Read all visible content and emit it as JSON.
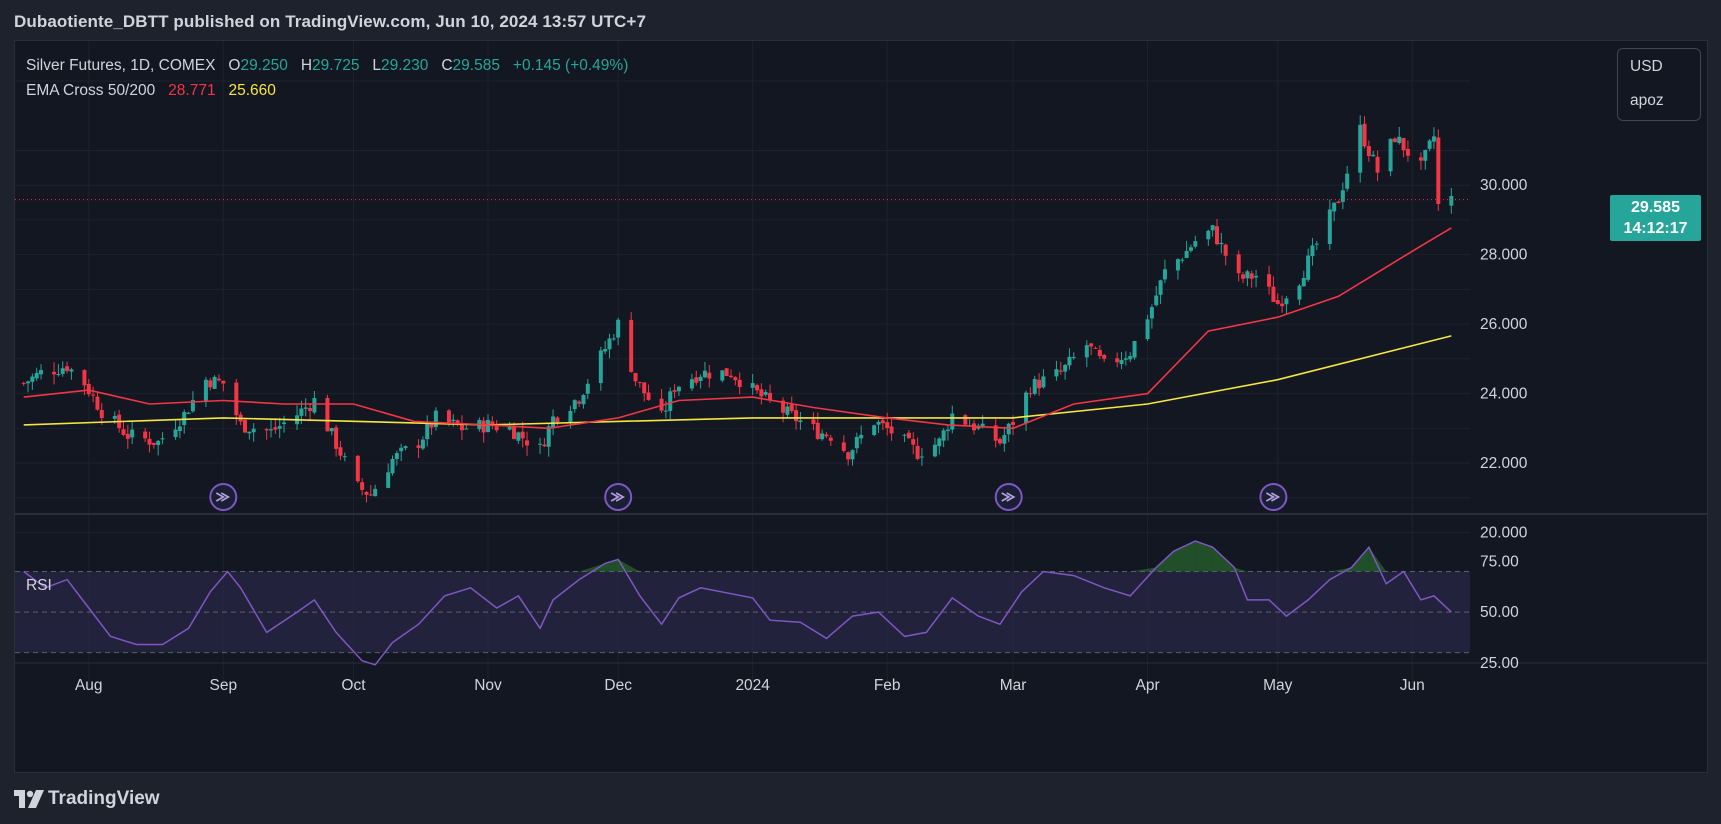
{
  "header": {
    "published_line": "Dubaotiente_DBTT published on TradingView.com, Jun 10, 2024 13:57 UTC+7"
  },
  "legend": {
    "symbol": "Silver Futures, 1D, COMEX",
    "open_key": "O",
    "open": "29.250",
    "high_key": "H",
    "high": "29.725",
    "low_key": "L",
    "low": "29.230",
    "close_key": "C",
    "close": "29.585",
    "change": "+0.145 (+0.49%)",
    "ema_label": "EMA Cross 50/200",
    "ema50": "28.771",
    "ema200": "25.660"
  },
  "currency": {
    "code": "USD",
    "unit": "apoz"
  },
  "price_badge": {
    "price": "29.585",
    "countdown": "14:12:17"
  },
  "rsi_label": "RSI",
  "footer": {
    "brand": "TradingView"
  },
  "colors": {
    "background": "#131722",
    "up": "#26a69a",
    "down": "#f23645",
    "ema50": "#f23645",
    "ema200": "#f5e642",
    "rsi_line": "#7e57c2",
    "rsi_band": "#2a2745",
    "grid": "#1e222d"
  },
  "chart_data": [
    {
      "type": "candlestick",
      "title": "Silver Futures, 1D, COMEX",
      "x_tick_labels": [
        "Aug",
        "Sep",
        "Oct",
        "Nov",
        "Dec",
        "2024",
        "Feb",
        "Mar",
        "Apr",
        "May",
        "Jun"
      ],
      "y_tick_labels": [
        "20.000",
        "22.000",
        "24.000",
        "26.000",
        "28.000",
        "30.000"
      ],
      "ylim": [
        19.9,
        33.0
      ],
      "current_price": 29.585,
      "price_path": [
        [
          "2023-07-17",
          24.3
        ],
        [
          "2023-07-21",
          24.6
        ],
        [
          "2023-07-27",
          24.8
        ],
        [
          "2023-07-31",
          24.3
        ],
        [
          "2023-08-04",
          23.5
        ],
        [
          "2023-08-10",
          22.8
        ],
        [
          "2023-08-17",
          22.6
        ],
        [
          "2023-08-23",
          23.4
        ],
        [
          "2023-08-28",
          24.4
        ],
        [
          "2023-09-01",
          24.3
        ],
        [
          "2023-09-05",
          23.1
        ],
        [
          "2023-09-12",
          22.9
        ],
        [
          "2023-09-18",
          23.4
        ],
        [
          "2023-09-22",
          23.8
        ],
        [
          "2023-09-26",
          22.8
        ],
        [
          "2023-10-02",
          21.3
        ],
        [
          "2023-10-05",
          21.1
        ],
        [
          "2023-10-10",
          22.1
        ],
        [
          "2023-10-16",
          22.6
        ],
        [
          "2023-10-20",
          23.3
        ],
        [
          "2023-10-26",
          23.0
        ],
        [
          "2023-11-01",
          23.1
        ],
        [
          "2023-11-06",
          23.0
        ],
        [
          "2023-11-13",
          22.4
        ],
        [
          "2023-11-16",
          23.3
        ],
        [
          "2023-11-22",
          23.9
        ],
        [
          "2023-11-28",
          25.3
        ],
        [
          "2023-12-01",
          26.0
        ],
        [
          "2023-12-05",
          24.4
        ],
        [
          "2023-12-11",
          23.3
        ],
        [
          "2023-12-14",
          24.2
        ],
        [
          "2023-12-20",
          24.6
        ],
        [
          "2023-12-27",
          24.6
        ],
        [
          "2024-01-02",
          24.0
        ],
        [
          "2024-01-08",
          23.5
        ],
        [
          "2024-01-16",
          22.9
        ],
        [
          "2024-01-19",
          22.8
        ],
        [
          "2024-01-23",
          22.3
        ],
        [
          "2024-01-29",
          23.2
        ],
        [
          "2024-02-02",
          22.9
        ],
        [
          "2024-02-08",
          22.3
        ],
        [
          "2024-02-13",
          22.6
        ],
        [
          "2024-02-16",
          23.4
        ],
        [
          "2024-02-22",
          23.0
        ],
        [
          "2024-02-27",
          22.6
        ],
        [
          "2024-03-01",
          23.2
        ],
        [
          "2024-03-05",
          24.2
        ],
        [
          "2024-03-12",
          24.6
        ],
        [
          "2024-03-18",
          25.4
        ],
        [
          "2024-03-22",
          24.8
        ],
        [
          "2024-03-28",
          25.2
        ],
        [
          "2024-04-02",
          26.5
        ],
        [
          "2024-04-05",
          27.5
        ],
        [
          "2024-04-10",
          28.1
        ],
        [
          "2024-04-12",
          28.4
        ],
        [
          "2024-04-16",
          28.7
        ],
        [
          "2024-04-22",
          27.3
        ],
        [
          "2024-04-26",
          27.4
        ],
        [
          "2024-05-01",
          26.6
        ],
        [
          "2024-05-06",
          27.3
        ],
        [
          "2024-05-10",
          28.3
        ],
        [
          "2024-05-15",
          29.6
        ],
        [
          "2024-05-20",
          31.6
        ],
        [
          "2024-05-24",
          30.4
        ],
        [
          "2024-05-28",
          31.4
        ],
        [
          "2024-06-03",
          30.5
        ],
        [
          "2024-06-06",
          31.4
        ],
        [
          "2024-06-07",
          29.4
        ],
        [
          "2024-06-10",
          29.585
        ]
      ],
      "ema50_path": [
        [
          "2023-07-17",
          23.9
        ],
        [
          "2023-08-01",
          24.1
        ],
        [
          "2023-08-15",
          23.7
        ],
        [
          "2023-09-01",
          23.8
        ],
        [
          "2023-09-15",
          23.7
        ],
        [
          "2023-10-01",
          23.7
        ],
        [
          "2023-10-15",
          23.2
        ],
        [
          "2023-11-01",
          23.1
        ],
        [
          "2023-11-15",
          23.0
        ],
        [
          "2023-12-01",
          23.3
        ],
        [
          "2023-12-15",
          23.8
        ],
        [
          "2024-01-01",
          23.9
        ],
        [
          "2024-01-15",
          23.6
        ],
        [
          "2024-02-01",
          23.3
        ],
        [
          "2024-02-15",
          23.1
        ],
        [
          "2024-03-01",
          23.0
        ],
        [
          "2024-03-15",
          23.7
        ],
        [
          "2024-04-01",
          24.0
        ],
        [
          "2024-04-15",
          25.8
        ],
        [
          "2024-05-01",
          26.2
        ],
        [
          "2024-05-15",
          26.8
        ],
        [
          "2024-06-01",
          28.1
        ],
        [
          "2024-06-10",
          28.771
        ]
      ],
      "ema200_path": [
        [
          "2023-07-17",
          23.1
        ],
        [
          "2023-09-01",
          23.3
        ],
        [
          "2023-11-01",
          23.1
        ],
        [
          "2024-01-01",
          23.3
        ],
        [
          "2024-02-01",
          23.3
        ],
        [
          "2024-03-01",
          23.3
        ],
        [
          "2024-04-01",
          23.7
        ],
        [
          "2024-05-01",
          24.4
        ],
        [
          "2024-06-10",
          25.66
        ]
      ],
      "series": [
        {
          "name": "EMA Cross 50/200 (50)",
          "last": 28.771
        },
        {
          "name": "EMA Cross 50/200 (200)",
          "last": 25.66
        }
      ],
      "event_marker_dates": [
        "2023-09-01",
        "2023-12-01",
        "2024-02-29",
        "2024-04-30"
      ]
    },
    {
      "type": "line",
      "title": "RSI",
      "y_tick_labels": [
        "25.00",
        "50.00",
        "75.00"
      ],
      "ylim": [
        16,
        90
      ],
      "bands": [
        30,
        50,
        70
      ],
      "rsi_path": [
        [
          "2023-07-17",
          70
        ],
        [
          "2023-07-22",
          62
        ],
        [
          "2023-07-27",
          66
        ],
        [
          "2023-08-01",
          52
        ],
        [
          "2023-08-06",
          38
        ],
        [
          "2023-08-12",
          34
        ],
        [
          "2023-08-18",
          34
        ],
        [
          "2023-08-24",
          42
        ],
        [
          "2023-08-29",
          60
        ],
        [
          "2023-09-02",
          70
        ],
        [
          "2023-09-05",
          62
        ],
        [
          "2023-09-11",
          40
        ],
        [
          "2023-09-18",
          50
        ],
        [
          "2023-09-22",
          56
        ],
        [
          "2023-09-27",
          40
        ],
        [
          "2023-10-03",
          26
        ],
        [
          "2023-10-06",
          24
        ],
        [
          "2023-10-10",
          35
        ],
        [
          "2023-10-16",
          44
        ],
        [
          "2023-10-22",
          58
        ],
        [
          "2023-10-28",
          62
        ],
        [
          "2023-11-03",
          52
        ],
        [
          "2023-11-08",
          58
        ],
        [
          "2023-11-13",
          42
        ],
        [
          "2023-11-16",
          56
        ],
        [
          "2023-11-22",
          66
        ],
        [
          "2023-11-28",
          74
        ],
        [
          "2023-12-01",
          76
        ],
        [
          "2023-12-06",
          58
        ],
        [
          "2023-12-11",
          44
        ],
        [
          "2023-12-15",
          57
        ],
        [
          "2023-12-20",
          62
        ],
        [
          "2024-01-01",
          57
        ],
        [
          "2024-01-05",
          46
        ],
        [
          "2024-01-12",
          45
        ],
        [
          "2024-01-18",
          37
        ],
        [
          "2024-01-24",
          48
        ],
        [
          "2024-01-30",
          50
        ],
        [
          "2024-02-05",
          38
        ],
        [
          "2024-02-10",
          40
        ],
        [
          "2024-02-16",
          57
        ],
        [
          "2024-02-22",
          48
        ],
        [
          "2024-02-27",
          44
        ],
        [
          "2024-03-03",
          60
        ],
        [
          "2024-03-08",
          70
        ],
        [
          "2024-03-15",
          68
        ],
        [
          "2024-03-22",
          62
        ],
        [
          "2024-03-28",
          58
        ],
        [
          "2024-04-03",
          72
        ],
        [
          "2024-04-07",
          80
        ],
        [
          "2024-04-12",
          85
        ],
        [
          "2024-04-16",
          82
        ],
        [
          "2024-04-21",
          72
        ],
        [
          "2024-04-24",
          56
        ],
        [
          "2024-04-29",
          56
        ],
        [
          "2024-05-03",
          48
        ],
        [
          "2024-05-08",
          56
        ],
        [
          "2024-05-13",
          66
        ],
        [
          "2024-05-18",
          72
        ],
        [
          "2024-05-22",
          82
        ],
        [
          "2024-05-26",
          64
        ],
        [
          "2024-05-30",
          70
        ],
        [
          "2024-06-03",
          56
        ],
        [
          "2024-06-06",
          58
        ],
        [
          "2024-06-10",
          50
        ]
      ]
    }
  ]
}
